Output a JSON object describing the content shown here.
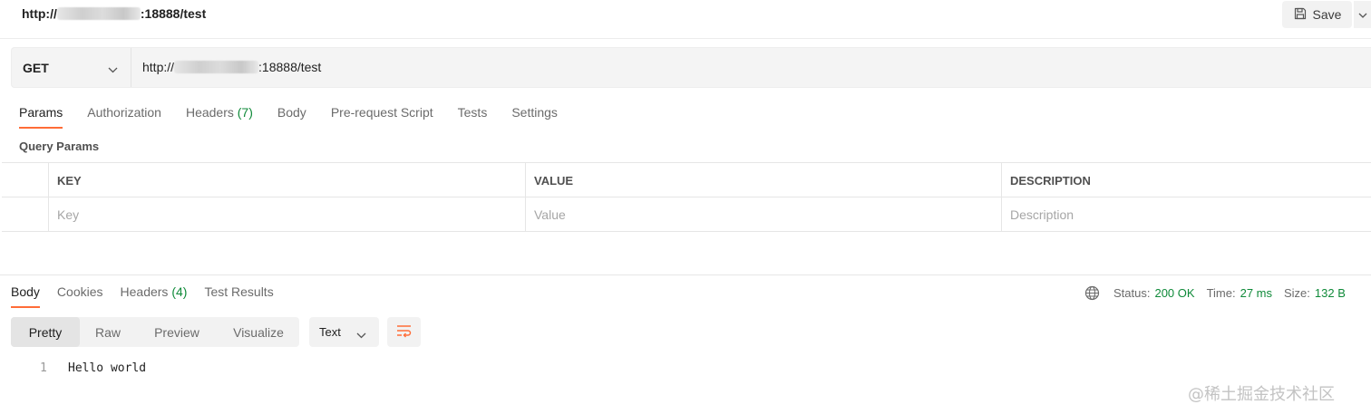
{
  "title": {
    "url_prefix": "http://",
    "url_suffix": ":18888/test"
  },
  "toolbar": {
    "save_label": "Save"
  },
  "request": {
    "method": "GET",
    "url_prefix": "http://",
    "url_suffix": ":18888/test"
  },
  "request_tabs": [
    {
      "label": "Params",
      "active": true
    },
    {
      "label": "Authorization"
    },
    {
      "label": "Headers",
      "count": "(7)"
    },
    {
      "label": "Body"
    },
    {
      "label": "Pre-request Script"
    },
    {
      "label": "Tests"
    },
    {
      "label": "Settings"
    }
  ],
  "query_params": {
    "label": "Query Params",
    "headers": [
      "KEY",
      "VALUE",
      "DESCRIPTION"
    ],
    "placeholders": [
      "Key",
      "Value",
      "Description"
    ]
  },
  "response_tabs": [
    {
      "label": "Body",
      "active": true
    },
    {
      "label": "Cookies"
    },
    {
      "label": "Headers",
      "count": "(4)"
    },
    {
      "label": "Test Results"
    }
  ],
  "status": {
    "status_label": "Status:",
    "status_value": "200 OK",
    "time_label": "Time:",
    "time_value": "27 ms",
    "size_label": "Size:",
    "size_value": "132 B"
  },
  "formats": [
    "Pretty",
    "Raw",
    "Preview",
    "Visualize"
  ],
  "content_type": "Text",
  "response_body": {
    "line_number": "1",
    "text": "Hello world"
  },
  "watermark": "@稀土掘金技术社区",
  "colors": {
    "accent": "#ff6c37",
    "success": "#0f8a39"
  },
  "icons": [
    "save-icon",
    "chevron-down-icon",
    "globe-icon",
    "wrap-lines-icon"
  ]
}
